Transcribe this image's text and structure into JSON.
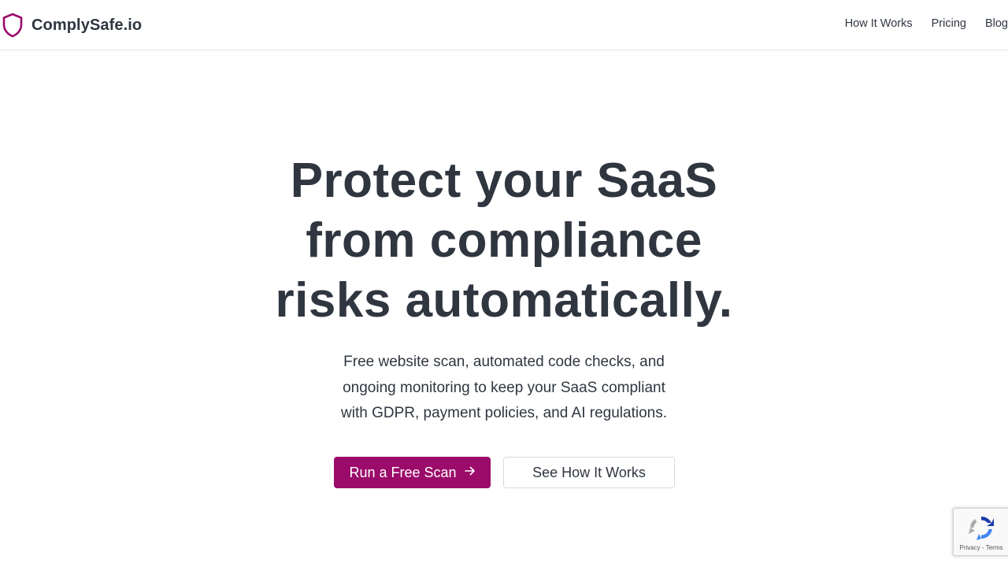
{
  "brand": {
    "name": "ComplySafe.io",
    "icon": "shield-icon",
    "accent_color": "#9b0c6a"
  },
  "nav": {
    "items": [
      {
        "label": "How It Works"
      },
      {
        "label": "Pricing"
      },
      {
        "label": "Blog"
      }
    ]
  },
  "hero": {
    "title_lines": [
      "Protect your SaaS",
      "from compliance",
      "risks automatically."
    ],
    "subtitle_lines": [
      "Free website scan, automated code checks, and",
      "ongoing monitoring to keep your SaaS compliant",
      "with GDPR, payment policies, and AI regulations."
    ],
    "primary_cta": {
      "label": "Run a Free Scan",
      "icon": "arrow-right-icon"
    },
    "secondary_cta": {
      "label": "See How It Works"
    }
  },
  "recaptcha": {
    "privacy_label": "Privacy",
    "separator": "-",
    "terms_label": "Terms"
  },
  "colors": {
    "text": "#2f3640",
    "primary_button": "#9b0c6a",
    "border": "#d9d9de"
  }
}
